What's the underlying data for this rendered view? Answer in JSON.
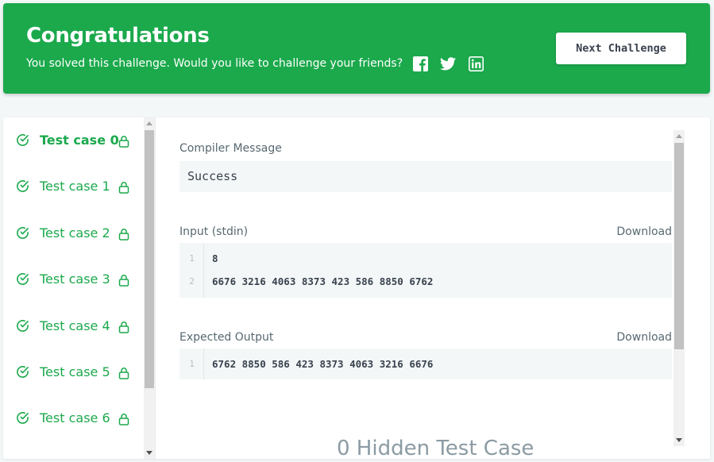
{
  "banner": {
    "title": "Congratulations",
    "subtitle": "You solved this challenge. Would you like to challenge your friends?",
    "share_icons": [
      "facebook-icon",
      "twitter-icon",
      "linkedin-icon"
    ],
    "next_button": "Next Challenge",
    "color": "#1ba94c"
  },
  "sidebar": {
    "test_cases": [
      {
        "label": "Test case 0",
        "active": true
      },
      {
        "label": "Test case 1",
        "active": false
      },
      {
        "label": "Test case 2",
        "active": false
      },
      {
        "label": "Test case 3",
        "active": false
      },
      {
        "label": "Test case 4",
        "active": false
      },
      {
        "label": "Test case 5",
        "active": false
      },
      {
        "label": "Test case 6",
        "active": false
      }
    ]
  },
  "content": {
    "compiler_label": "Compiler Message",
    "compiler_message": "Success",
    "input_label": "Input (stdin)",
    "input_download": "Download",
    "input_lines": [
      {
        "num": "1",
        "text": "8"
      },
      {
        "num": "2",
        "text": "6676 3216 4063 8373 423 586 8850 6762"
      }
    ],
    "expected_label": "Expected Output",
    "expected_download": "Download",
    "expected_lines": [
      {
        "num": "1",
        "text": "6762 8850 586 423 8373 4063 3216 6676"
      }
    ],
    "hidden_title": "0 Hidden Test Case"
  }
}
